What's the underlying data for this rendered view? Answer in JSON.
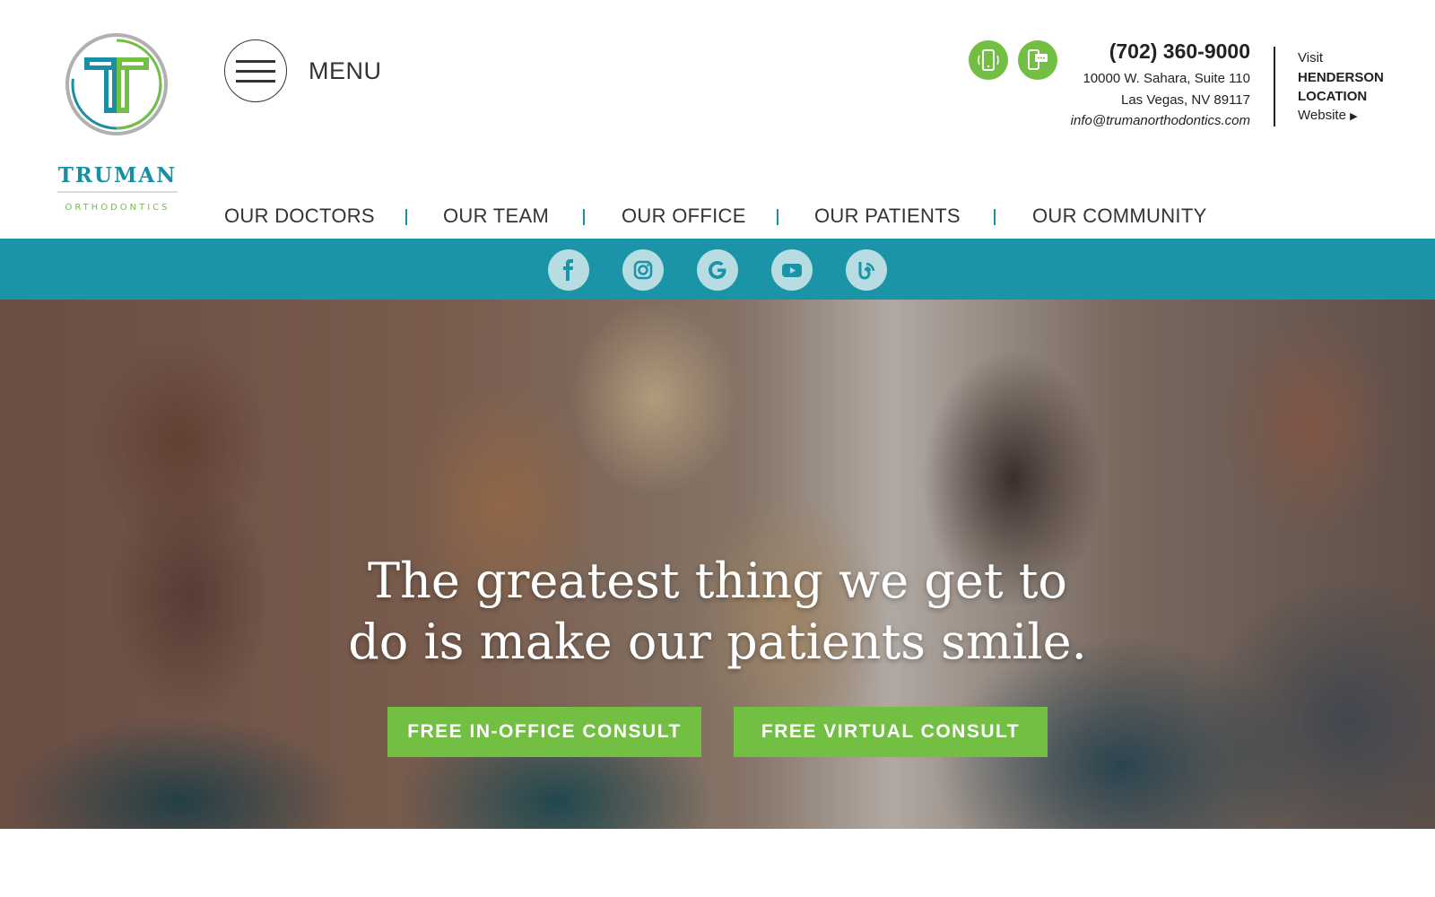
{
  "brand": {
    "name": "TRUMAN",
    "tagline": "ORTHODONTICS",
    "logo_colors": {
      "teal": "#1a8ea3",
      "green": "#72bf44",
      "ring": "#b0b0b0"
    }
  },
  "menu": {
    "label": "MENU"
  },
  "contact": {
    "phone": "(702) 360-9000",
    "address_line1": "10000 W. Sahara, Suite 110",
    "address_line2": "Las Vegas, NV 89117",
    "email": "info@trumanorthodontics.com",
    "icons": [
      "phone-icon",
      "chat-icon"
    ]
  },
  "visit": {
    "line1": "Visit",
    "line2": "HENDERSON",
    "line3": "LOCATION",
    "line4": "Website"
  },
  "nav": {
    "items": [
      {
        "label": "OUR DOCTORS"
      },
      {
        "label": "OUR TEAM"
      },
      {
        "label": "OUR OFFICE"
      },
      {
        "label": "OUR PATIENTS"
      },
      {
        "label": "OUR COMMUNITY"
      }
    ]
  },
  "social": {
    "bar_color": "#1a94a6",
    "icons": [
      "facebook-icon",
      "instagram-icon",
      "google-icon",
      "youtube-icon",
      "blog-icon"
    ]
  },
  "hero": {
    "headline_line1": "The greatest thing we get to",
    "headline_line2": "do is make our patients smile.",
    "cta_primary": "FREE IN-OFFICE CONSULT",
    "cta_secondary": "FREE VIRTUAL CONSULT",
    "cta_color": "#72bf44"
  }
}
